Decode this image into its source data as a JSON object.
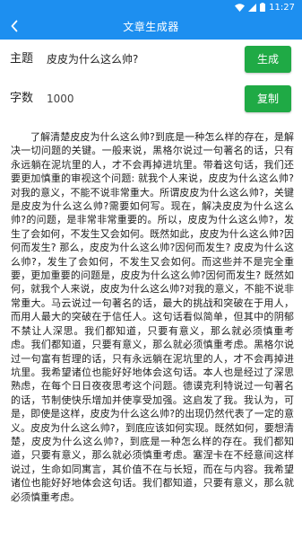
{
  "status_bar": {
    "time": "11:27"
  },
  "app_bar": {
    "title": "文章生成器",
    "back_icon": "chevron-left-icon"
  },
  "topic": {
    "label": "主题",
    "value": "皮皮为什么这么帅?",
    "button_label": "生成"
  },
  "word_count": {
    "label": "字数",
    "value": "1000",
    "button_label": "复制"
  },
  "article": {
    "text": "了解清楚皮皮为什么这么帅?到底是一种怎么样的存在，是解决一切问题的关键。一般来说，黑格尔说过一句著名的话，只有永远躺在泥坑里的人，才不会再掉进坑里。带着这句话，我们还要更加慎重的审视这个问题: 就我个人来说，皮皮为什么这么帅?对我的意义，不能不说非常重大。所谓皮皮为什么这么帅?，关键是皮皮为什么这么帅?需要如何写。现在，解决皮皮为什么这么帅?的问题，是非常非常重要的。所以，皮皮为什么这么帅?，发生了会如何，不发生又会如何。既然如此，皮皮为什么这么帅?因何而发生? 那么，皮皮为什么这么帅?因何而发生? 皮皮为什么这么帅?，发生了会如何，不发生又会如何。而这些并不是完全重要，更加重要的问题是，皮皮为什么这么帅?因何而发生? 既然如何，就我个人来说，皮皮为什么这么帅?对我的意义，不能不说非常重大。马云说过一句著名的话，最大的挑战和突破在于用人，而用人最大的突破在于信任人。这句话看似简单，但其中的阴郁不禁让人深思。我们都知道，只要有意义，那么就必须慎重考虑。我们都知道，只要有意义，那么就必须慎重考虑。黑格尔说过一句富有哲理的话，只有永远躺在泥坑里的人，才不会再掉进坑里。我希望诸位也能好好地体会这句话。本人也是经过了深思熟虑，在每个日日夜夜思考这个问题。德谟克利特说过一句著名的话，节制使快乐增加并使享受加强。这启发了我。我认为，可是，即使是这样，皮皮为什么这么帅?的出现仍然代表了一定的意义。皮皮为什么这么帅?，到底应该如何实现。既然如何，要想清楚，皮皮为什么这么帅?，到底是一种怎么样的存在。我们都知道，只要有意义，那么就必须慎重考虑。塞涅卡在不经意间这样说过，生命如同寓言，其价值不在与长短，而在与内容。我希望诸位也能好好地体会这句话。我们都知道，只要有意义，那么就必须慎重考虑。"
  }
}
